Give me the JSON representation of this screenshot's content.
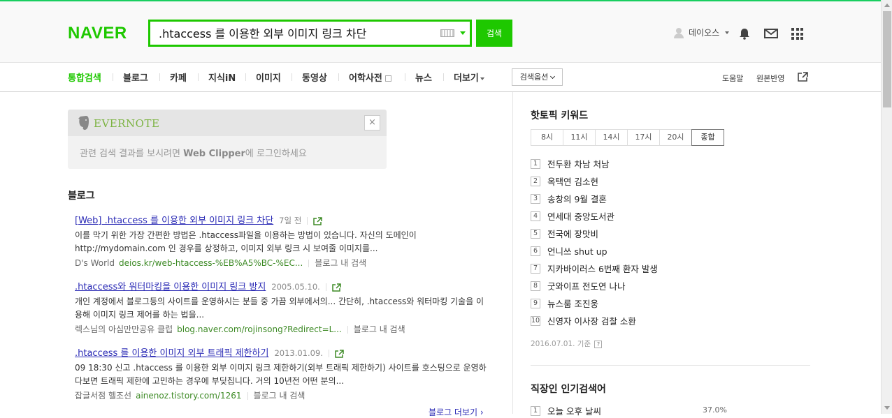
{
  "header": {
    "logo": "NAVER",
    "search_value": ".htaccess 를 이용한 외부 이미지 링크 차단",
    "search_button": "검색",
    "user_name": "데이오스"
  },
  "tabs": {
    "items": [
      "통합검색",
      "블로그",
      "카페",
      "지식iN",
      "이미지",
      "동영상",
      "어학사전",
      "뉴스",
      "더보기"
    ],
    "options_label": "검색옵션",
    "help": "도움말",
    "original": "원본반영"
  },
  "evernote": {
    "brand": "EVERNOTE",
    "close": "×",
    "message_pre": "관련 검색 결과를 보시려면 ",
    "message_bold": "Web Clipper",
    "message_post": "에 로그인하세요"
  },
  "blog": {
    "section_title": "블로그",
    "results": [
      {
        "title": "[Web] .htaccess 를 이용한 외부 이미지 링크 차단",
        "date": "7일 전",
        "desc": "이를 막기 위한 가장 간편한 방법은 .htaccess파일을 이용하는 방법이 있습니다. 자신의 도메인이 http://mydomain.com 인 경우를 상정하고, 이미지 외부 링크 시 보여줄 이미지를...",
        "source": "D's World",
        "url": "deios.kr/web-htaccess-%EB%A5%BC-%EC...",
        "in_blog": "블로그 내 검색"
      },
      {
        "title": ".htaccess와 워터마킹을 이용한 이미지 링크 방지",
        "date": "2005.05.10.",
        "desc": "개인 계정에서 블로그등의 사이트를 운영하시는 분들 중 가끔 외부에서의... 간단히, .htaccess와 워터마킹 기술을 이용해 이미지 링크 제어를 하는 법을...",
        "source": "렉스님의 아심만만공유 클럽",
        "url": "blog.naver.com/rojinsong?Redirect=L...",
        "in_blog": "블로그 내 검색"
      },
      {
        "title": ".htaccess 를 이용한 이미지 외부 트래픽 제한하기",
        "date": "2013.01.09.",
        "desc": "09 18:30 신고 .htaccess 를 이용한 외부 이미지 링크 제한하기(외부 트래픽 제한하기) 사이트를 호스팅으로 운영하다보면 트래픽 제한에 고민하는 경우에 부딪칩니다. 거의 10년전 어떤 분의...",
        "source": "잡글서점 헬조선",
        "url": "ainenoz.tistory.com/1261",
        "in_blog": "블로그 내 검색"
      }
    ],
    "more": "블로그 더보기 ›"
  },
  "hot": {
    "title": "핫토픽 키워드",
    "time_tabs": [
      "8시",
      "11시",
      "14시",
      "17시",
      "20시",
      "종합"
    ],
    "active_tab": "종합",
    "keywords": [
      "전두환 차남 처남",
      "옥택연 김소현",
      "송창의 9월 결혼",
      "연세대 중앙도서관",
      "전국에 장맛비",
      "언니쓰 shut up",
      "지카바이러스 6번째 환자 발생",
      "굿와이프 전도연 나나",
      "뉴스룸 조진웅",
      "신영자 이사장 검찰 소환"
    ],
    "basis": "2016.07.01. 기준",
    "help": "?"
  },
  "popular": {
    "title": "직장인 인기검색어",
    "first": "오늘 오후 날씨",
    "first_num": "1",
    "first_pct": "37.0%"
  }
}
